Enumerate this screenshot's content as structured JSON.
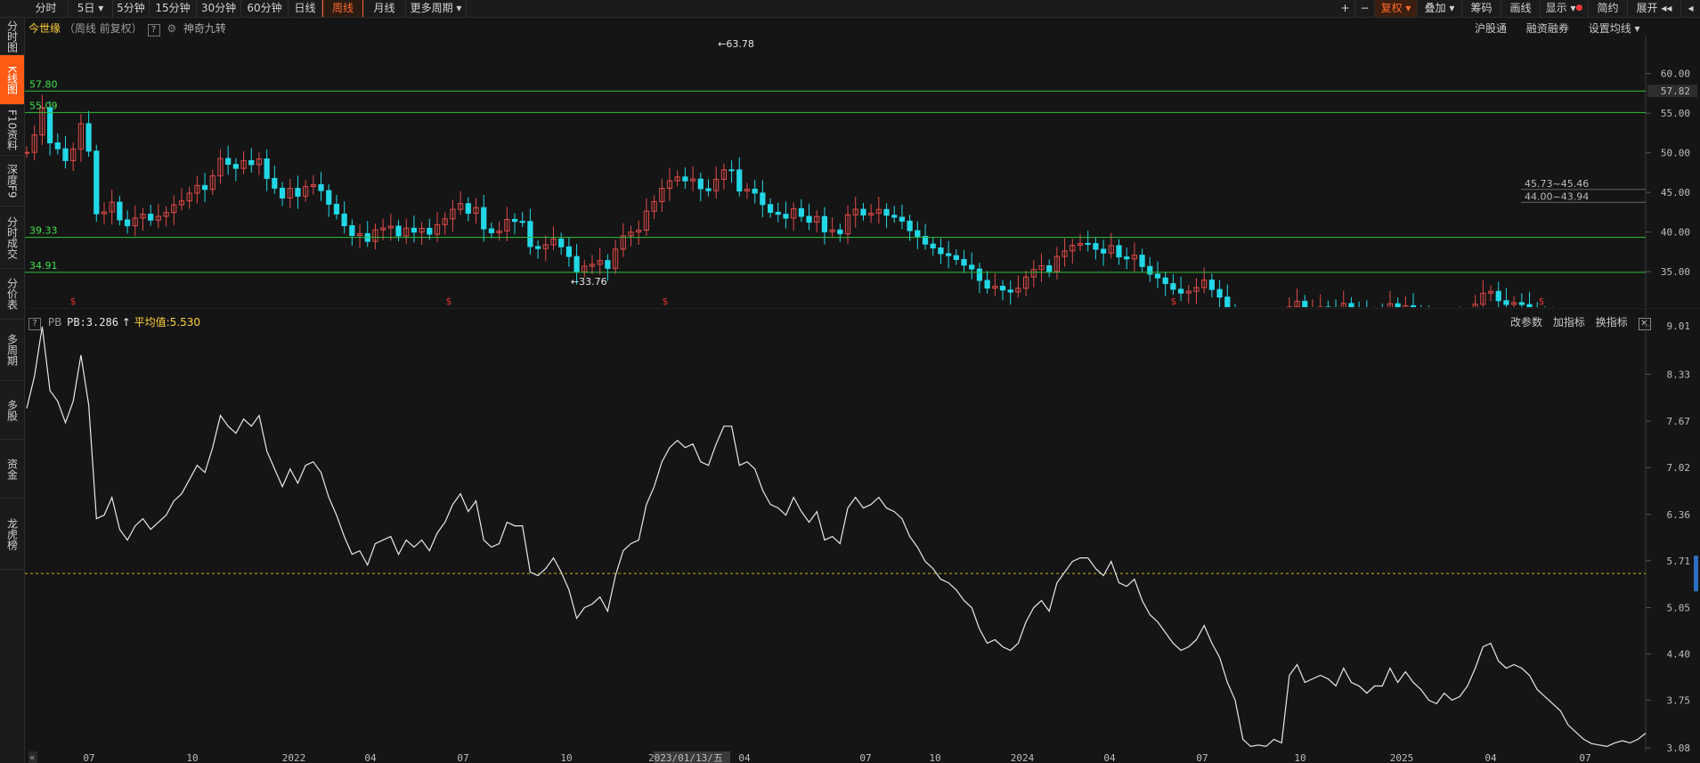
{
  "toolbar": {
    "periods": [
      "分时",
      "5日",
      "5分钟",
      "15分钟",
      "30分钟",
      "60分钟",
      "日线",
      "周线",
      "月线",
      "更多周期"
    ],
    "active_period": "周线",
    "right_buttons": [
      "+",
      "−",
      "复权",
      "叠加",
      "筹码",
      "画线",
      "显示",
      "简约",
      "展开"
    ]
  },
  "leftnav": [
    {
      "label": "分时图"
    },
    {
      "label": "K线图"
    },
    {
      "label": "F10资料"
    },
    {
      "label": "深度F9"
    },
    {
      "label": "分时成交"
    },
    {
      "label": "分价表"
    },
    {
      "label": "多周期"
    },
    {
      "label": "多股"
    },
    {
      "label": "资金"
    },
    {
      "label": "龙虎榜"
    }
  ],
  "kline": {
    "stock_name": "今世缘",
    "mode": "（周线 前复权）",
    "help": "?",
    "indicator": "神奇九转",
    "right_links": [
      "沪股通",
      "融资融券",
      "设置均线"
    ],
    "y_ticks": [
      "60.00",
      "55.00",
      "50.00",
      "45.00",
      "40.00",
      "35.00"
    ],
    "current_price": "57.82",
    "levels": [
      {
        "label": "57.80",
        "value": 57.8
      },
      {
        "label": "55.09",
        "value": 55.09
      },
      {
        "label": "39.33",
        "value": 39.33
      },
      {
        "label": "34.91",
        "value": 34.91
      }
    ],
    "annotations": {
      "high": "63.78",
      "low": "33.76",
      "zone1": "45.73~45.46",
      "zone2": "44.00~43.94"
    },
    "marker": "$",
    "up_color": "#e04a4a",
    "down_color": "#22d7e6"
  },
  "pb": {
    "name": "PB",
    "value_text": "PB:3.286",
    "avg_text": "平均值:5.530",
    "avg": 5.53,
    "right_links": [
      "改参数",
      "加指标",
      "换指标"
    ],
    "y_ticks": [
      "9.01",
      "8.33",
      "7.67",
      "7.02",
      "6.36",
      "5.71",
      "5.05",
      "4.40",
      "3.75",
      "3.08"
    ],
    "series": [
      7.85,
      8.3,
      9.0,
      8.1,
      7.95,
      7.65,
      7.95,
      8.6,
      7.9,
      6.3,
      6.35,
      6.6,
      6.15,
      6.0,
      6.2,
      6.3,
      6.15,
      6.25,
      6.35,
      6.55,
      6.65,
      6.85,
      7.05,
      6.95,
      7.3,
      7.75,
      7.6,
      7.5,
      7.7,
      7.6,
      7.75,
      7.25,
      7.0,
      6.75,
      7.0,
      6.8,
      7.05,
      7.1,
      6.95,
      6.6,
      6.35,
      6.05,
      5.8,
      5.85,
      5.65,
      5.95,
      6.0,
      6.05,
      5.8,
      6.0,
      5.9,
      6.0,
      5.85,
      6.1,
      6.25,
      6.5,
      6.65,
      6.4,
      6.55,
      6.0,
      5.9,
      5.95,
      6.25,
      6.2,
      6.2,
      5.55,
      5.5,
      5.6,
      5.75,
      5.55,
      5.3,
      4.9,
      5.05,
      5.1,
      5.2,
      5.0,
      5.5,
      5.85,
      5.95,
      6.0,
      6.5,
      6.75,
      7.1,
      7.3,
      7.4,
      7.3,
      7.35,
      7.1,
      7.05,
      7.35,
      7.6,
      7.6,
      7.05,
      7.1,
      7.0,
      6.7,
      6.5,
      6.45,
      6.35,
      6.6,
      6.4,
      6.25,
      6.4,
      6.0,
      6.05,
      5.95,
      6.45,
      6.6,
      6.45,
      6.5,
      6.6,
      6.45,
      6.4,
      6.3,
      6.05,
      5.9,
      5.7,
      5.6,
      5.45,
      5.4,
      5.3,
      5.15,
      5.05,
      4.75,
      4.55,
      4.6,
      4.5,
      4.45,
      4.55,
      4.85,
      5.05,
      5.15,
      5.0,
      5.4,
      5.55,
      5.7,
      5.75,
      5.75,
      5.6,
      5.5,
      5.7,
      5.4,
      5.35,
      5.45,
      5.15,
      4.95,
      4.85,
      4.7,
      4.55,
      4.45,
      4.5,
      4.6,
      4.8,
      4.55,
      4.35,
      4.0,
      3.75,
      3.2,
      3.1,
      3.12,
      3.1,
      3.2,
      3.15,
      4.1,
      4.25,
      4.0,
      4.05,
      4.1,
      4.05,
      3.95,
      4.2,
      4.0,
      3.95,
      3.85,
      3.95,
      3.95,
      4.2,
      4.0,
      4.15,
      4.0,
      3.9,
      3.75,
      3.7,
      3.85,
      3.75,
      3.8,
      3.95,
      4.2,
      4.5,
      4.55,
      4.3,
      4.2,
      4.25,
      4.2,
      4.1,
      3.9,
      3.8,
      3.7,
      3.6,
      3.4,
      3.3,
      3.2,
      3.14,
      3.12,
      3.1,
      3.15,
      3.18,
      3.15,
      3.2,
      3.286
    ]
  },
  "x_axis": [
    "07",
    "10",
    "2022",
    "04",
    "07",
    "10",
    "2023/01/13/五",
    "04",
    "07",
    "10",
    "2024",
    "04",
    "07",
    "10",
    "2025",
    "04",
    "07"
  ],
  "chart_data": {
    "type": "candlestick+line",
    "title": "今世缘 （周线 前复权）",
    "series": [
      {
        "name": "PB",
        "type": "line",
        "values_ref": "pb.series",
        "ylim": [
          3.08,
          9.01
        ],
        "avg": 5.53
      }
    ],
    "price_ylim": [
      33.0,
      62.0
    ],
    "price_levels": [
      57.8,
      55.09,
      39.33,
      34.91
    ],
    "high": 63.78,
    "low": 33.76,
    "last_price": 57.82,
    "x_ticks": [
      "07",
      "10",
      "2022",
      "04",
      "07",
      "10",
      "2023/01/13/五",
      "04",
      "07",
      "10",
      "2024",
      "04",
      "07",
      "10",
      "2025",
      "04",
      "07"
    ]
  }
}
